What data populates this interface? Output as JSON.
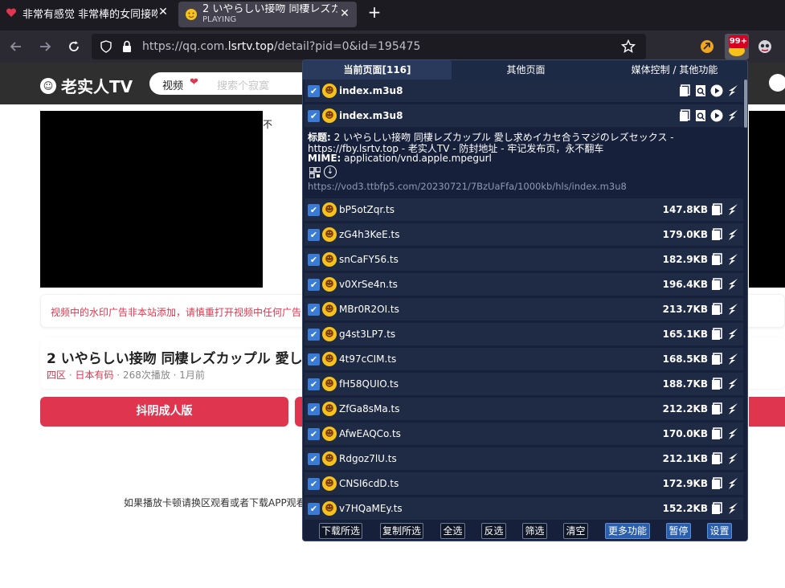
{
  "browser": {
    "tabs": [
      {
        "title": "非常有感觉 非常棒的女同接吻",
        "active": false
      },
      {
        "title": "2 いやらしい接吻 同棲レズカ",
        "subtitle": "PLAYING",
        "active": true
      }
    ],
    "url_prefix": "https://qq.com.",
    "url_host": "lsrtv.top",
    "url_path": "/detail?pid=0&id=195475",
    "extension_badge": "99+"
  },
  "site": {
    "logo": "老实人TV",
    "search_category": "视频",
    "search_placeholder": "搜索个寂寞",
    "video_overlay_text": "不",
    "notice": "视频中的水印广告非本站添加，请慎重打开视频中任何广告",
    "video_title": "2 いやらしい接吻 同棲レズカップル 愛し",
    "meta_region": "四区",
    "meta_sep": " · ",
    "meta_category": "日本有码",
    "meta_rest": " · 268次播放 · 1月前",
    "ad_button": "抖阴成人版",
    "hint": "如果播放卡顿请换区观看或者下载APP观看"
  },
  "panel": {
    "tabs": [
      "当前页面[116]",
      "其他页面",
      "媒体控制 / 其他功能"
    ],
    "m3u8_rows": [
      {
        "name": "index.m3u8"
      },
      {
        "name": "index.m3u8"
      }
    ],
    "detail": {
      "title_label": "标题:",
      "title": "2 いやらしい接吻 同棲レズカップル 愛し求めイカセ合うマジのレズセックス -",
      "source": "https://fby.lsrtv.top - 老实人TV - 防封地址 - 牢记发布页，永不翻车",
      "mime_label": "MIME:",
      "mime": "application/vnd.apple.mpegurl",
      "url": "https://vod3.ttbfp5.com/20230721/7BzUaFfa/1000kb/hls/index.m3u8"
    },
    "ts_rows": [
      {
        "name": "bP5otZqr.ts",
        "size": "147.8KB"
      },
      {
        "name": "zG4h3KeE.ts",
        "size": "179.0KB"
      },
      {
        "name": "snCaFY56.ts",
        "size": "182.9KB"
      },
      {
        "name": "v0XrSe4n.ts",
        "size": "196.4KB"
      },
      {
        "name": "MBr0R2OI.ts",
        "size": "213.7KB"
      },
      {
        "name": "g4st3LP7.ts",
        "size": "165.1KB"
      },
      {
        "name": "4t97cCIM.ts",
        "size": "168.5KB"
      },
      {
        "name": "fH58QUIO.ts",
        "size": "188.7KB"
      },
      {
        "name": "ZfGa8sMa.ts",
        "size": "212.2KB"
      },
      {
        "name": "AfwEAQCo.ts",
        "size": "170.0KB"
      },
      {
        "name": "Rdgoz7lU.ts",
        "size": "212.1KB"
      },
      {
        "name": "CNSI6cdD.ts",
        "size": "172.9KB"
      },
      {
        "name": "v7HQaMEy.ts",
        "size": "152.2KB"
      }
    ],
    "footer": [
      "下载所选",
      "复制所选",
      "全选",
      "反选",
      "筛选",
      "清空",
      "更多功能",
      "暂停",
      "设置"
    ]
  },
  "colors": {
    "panel_bg": "#16203a",
    "row_bg": "#1f2b45",
    "accent_red": "#e0354f",
    "checkbox_blue": "#3a7bd5"
  }
}
